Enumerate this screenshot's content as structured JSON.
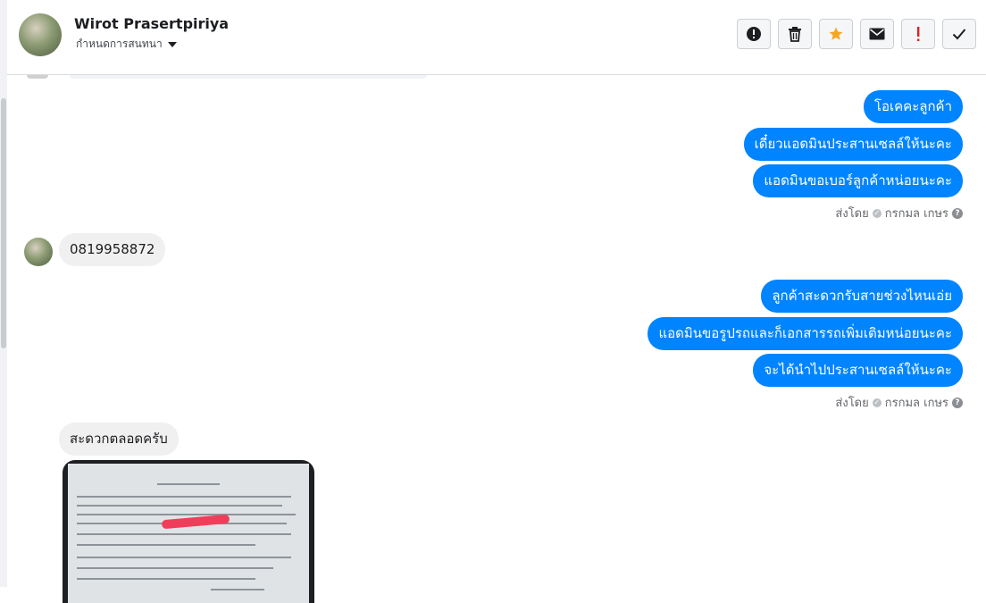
{
  "header": {
    "contact_name": "Wirot Prasertpiriya",
    "subtitle": "กำหนดการสนทนา"
  },
  "toolbar": {
    "buttons": [
      {
        "name": "spam",
        "icon": "alert-circle-icon",
        "glyph": "!"
      },
      {
        "name": "delete",
        "icon": "trash-icon"
      },
      {
        "name": "star",
        "icon": "star-icon",
        "glyph": "★",
        "color": "#f5a623"
      },
      {
        "name": "mark-unread",
        "icon": "envelope-icon"
      },
      {
        "name": "follow-up",
        "icon": "exclamation-icon",
        "glyph": "!",
        "color": "#e02020"
      },
      {
        "name": "done",
        "icon": "checkmark-icon",
        "glyph": "✓"
      }
    ]
  },
  "messages": {
    "group1": [
      "โอเคคะลูกค้า",
      "เดี๋ยวแอดมินประสานเซลล์ให้นะคะ",
      "แอดมินขอเบอร์ลูกค้าหน่อยนะคะ"
    ],
    "sent_by_1": "ส่งโดย",
    "sender_1": "กรกมล เกษร",
    "incoming_phone": "0819958872",
    "group2": [
      "ลูกค้าสะดวกรับสายช่วงไหนเอ่ย",
      "แอดมินขอรูปรถและก็เอกสารรถเพิ่มเติมหน่อยนะคะ",
      "จะได้นำไปประสานเซลล์ให้นะคะ"
    ],
    "sent_by_2": "ส่งโดย",
    "sender_2": "กรกมล เกษร",
    "incoming_reply": "สะดวกตลอดครับ"
  },
  "colors": {
    "outgoing_bubble": "#0084ff",
    "incoming_bubble": "#f1f0f0"
  }
}
